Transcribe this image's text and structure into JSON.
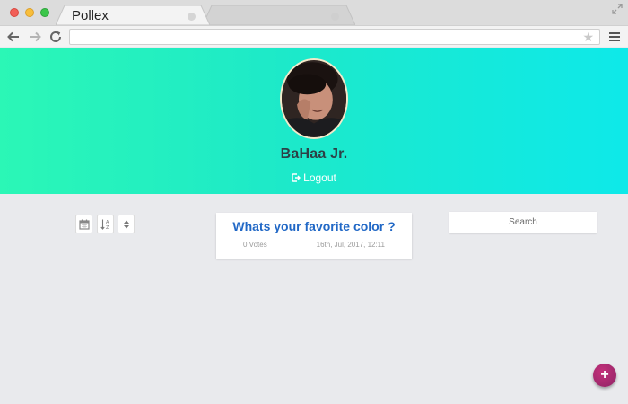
{
  "browser": {
    "tabs": [
      {
        "title": "Pollex",
        "active": true
      },
      {
        "title": "",
        "active": false
      }
    ],
    "address": ""
  },
  "profile": {
    "name": "BaHaa Jr.",
    "logout_label": "Logout"
  },
  "toolbar": {
    "icons": [
      "calendar-icon",
      "sort-alpha-icon",
      "sort-updown-icon"
    ]
  },
  "polls": [
    {
      "question": "Whats your favorite color ?",
      "votes": "0 Votes",
      "date": "16th, Jul, 2017, 12:11"
    }
  ],
  "search": {
    "placeholder": "Search"
  },
  "fab": {
    "label": "+"
  },
  "colors": {
    "hero_start": "#2bf7b6",
    "hero_end": "#0ee9e9",
    "poll_title": "#2168c6",
    "fab": "#a82a6f",
    "page_bg": "#e9eaed"
  }
}
